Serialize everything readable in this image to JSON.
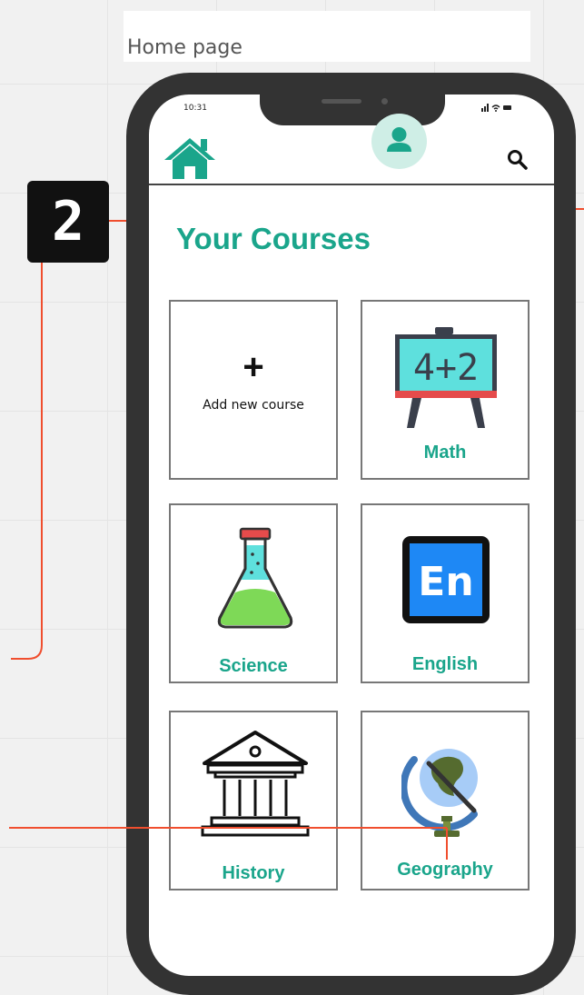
{
  "frame": {
    "title": "Home page"
  },
  "step_badge": {
    "number": "2"
  },
  "status_bar": {
    "time": "10:31",
    "icons": "signal-wifi-battery"
  },
  "header": {
    "home_icon": "home-icon",
    "search_icon": "search-icon"
  },
  "profile": {
    "icon": "user-icon"
  },
  "page": {
    "title": "Your Courses"
  },
  "courses": {
    "add": {
      "plus": "+",
      "label": "Add new course"
    },
    "items": [
      {
        "label": "Math",
        "icon": "chalkboard-icon",
        "board_text": "4+2"
      },
      {
        "label": "Science",
        "icon": "flask-icon"
      },
      {
        "label": "English",
        "icon": "english-icon",
        "badge_text": "En"
      },
      {
        "label": "History",
        "icon": "museum-icon"
      },
      {
        "label": "Geography",
        "icon": "globe-icon"
      }
    ]
  },
  "colors": {
    "accent": "#1aa58b",
    "connector": "#f04e2e",
    "phone": "#333333",
    "avatar_bg": "#cfeee6",
    "english_tile": "#1e88f5",
    "flask_liquid": "#7ed957",
    "board": "#5ee0dd",
    "board_ledge": "#e54b4b"
  }
}
